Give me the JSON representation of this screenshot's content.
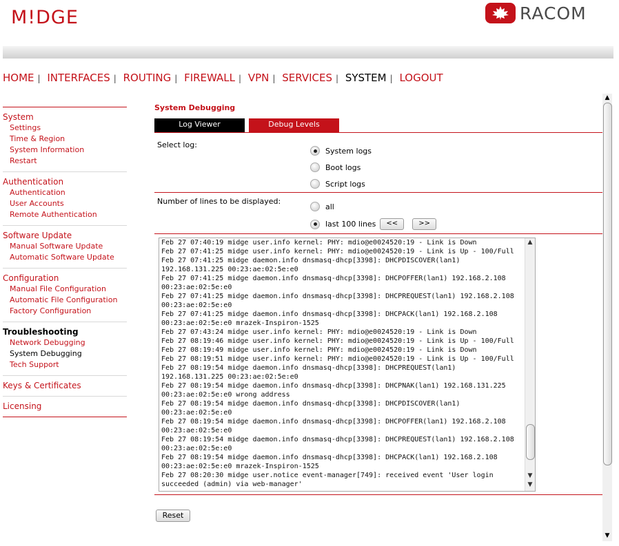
{
  "brand": {
    "product": "M!DGE",
    "vendor": "RACOM"
  },
  "nav": [
    {
      "label": "HOME",
      "active": false
    },
    {
      "label": "INTERFACES",
      "active": false
    },
    {
      "label": "ROUTING",
      "active": false
    },
    {
      "label": "FIREWALL",
      "active": false
    },
    {
      "label": "VPN",
      "active": false
    },
    {
      "label": "SERVICES",
      "active": false
    },
    {
      "label": "SYSTEM",
      "active": true
    },
    {
      "label": "LOGOUT",
      "active": false
    }
  ],
  "sidebar": [
    {
      "title": "System",
      "current": false,
      "items": [
        {
          "label": "Settings",
          "current": false
        },
        {
          "label": "Time & Region",
          "current": false
        },
        {
          "label": "System Information",
          "current": false
        },
        {
          "label": "Restart",
          "current": false
        }
      ]
    },
    {
      "title": "Authentication",
      "current": false,
      "items": [
        {
          "label": "Authentication",
          "current": false
        },
        {
          "label": "User Accounts",
          "current": false
        },
        {
          "label": "Remote Authentication",
          "current": false
        }
      ]
    },
    {
      "title": "Software Update",
      "current": false,
      "items": [
        {
          "label": "Manual Software Update",
          "current": false
        },
        {
          "label": "Automatic Software Update",
          "current": false
        }
      ]
    },
    {
      "title": "Configuration",
      "current": false,
      "items": [
        {
          "label": "Manual File Configuration",
          "current": false
        },
        {
          "label": "Automatic File Configuration",
          "current": false
        },
        {
          "label": "Factory Configuration",
          "current": false
        }
      ]
    },
    {
      "title": "Troubleshooting",
      "current": true,
      "items": [
        {
          "label": "Network Debugging",
          "current": false
        },
        {
          "label": "System Debugging",
          "current": true
        },
        {
          "label": "Tech Support",
          "current": false
        }
      ]
    },
    {
      "title": "Keys & Certificates",
      "current": false,
      "items": []
    },
    {
      "title": "Licensing",
      "current": false,
      "items": []
    }
  ],
  "page": {
    "title": "System Debugging",
    "tabs": [
      {
        "label": "Log Viewer",
        "active": true
      },
      {
        "label": "Debug Levels",
        "active": false
      }
    ],
    "select_log": {
      "label": "Select log:",
      "options": [
        {
          "label": "System logs",
          "selected": true
        },
        {
          "label": "Boot logs",
          "selected": false
        },
        {
          "label": "Script logs",
          "selected": false
        }
      ]
    },
    "lines": {
      "label": "Number of lines to be displayed:",
      "options": [
        {
          "label": "all",
          "selected": false
        },
        {
          "label": "last 100 lines",
          "selected": true
        }
      ],
      "prev_label": "<<",
      "next_label": ">>"
    },
    "log": [
      "Feb 27 07:40:19 midge user.info kernel: PHY: mdio@e0024520:19 - Link is Down",
      "Feb 27 07:41:25 midge user.info kernel: PHY: mdio@e0024520:19 - Link is Up - 100/Full",
      "Feb 27 07:41:25 midge daemon.info dnsmasq-dhcp[3398]: DHCPDISCOVER(lan1)",
      "192.168.131.225 00:23:ae:02:5e:e0",
      "Feb 27 07:41:25 midge daemon.info dnsmasq-dhcp[3398]: DHCPOFFER(lan1) 192.168.2.108",
      "00:23:ae:02:5e:e0",
      "Feb 27 07:41:25 midge daemon.info dnsmasq-dhcp[3398]: DHCPREQUEST(lan1) 192.168.2.108",
      "00:23:ae:02:5e:e0",
      "Feb 27 07:41:25 midge daemon.info dnsmasq-dhcp[3398]: DHCPACK(lan1) 192.168.2.108",
      "00:23:ae:02:5e:e0 mrazek-Inspiron-1525",
      "Feb 27 07:43:24 midge user.info kernel: PHY: mdio@e0024520:19 - Link is Down",
      "Feb 27 08:19:46 midge user.info kernel: PHY: mdio@e0024520:19 - Link is Up - 100/Full",
      "Feb 27 08:19:49 midge user.info kernel: PHY: mdio@e0024520:19 - Link is Down",
      "Feb 27 08:19:51 midge user.info kernel: PHY: mdio@e0024520:19 - Link is Up - 100/Full",
      "Feb 27 08:19:54 midge daemon.info dnsmasq-dhcp[3398]: DHCPREQUEST(lan1)",
      "192.168.131.225 00:23:ae:02:5e:e0",
      "Feb 27 08:19:54 midge daemon.info dnsmasq-dhcp[3398]: DHCPNAK(lan1) 192.168.131.225",
      "00:23:ae:02:5e:e0 wrong address",
      "Feb 27 08:19:54 midge daemon.info dnsmasq-dhcp[3398]: DHCPDISCOVER(lan1)",
      "00:23:ae:02:5e:e0",
      "Feb 27 08:19:54 midge daemon.info dnsmasq-dhcp[3398]: DHCPOFFER(lan1) 192.168.2.108",
      "00:23:ae:02:5e:e0",
      "Feb 27 08:19:54 midge daemon.info dnsmasq-dhcp[3398]: DHCPREQUEST(lan1) 192.168.2.108",
      "00:23:ae:02:5e:e0",
      "Feb 27 08:19:54 midge daemon.info dnsmasq-dhcp[3398]: DHCPACK(lan1) 192.168.2.108",
      "00:23:ae:02:5e:e0 mrazek-Inspiron-1525",
      "Feb 27 08:20:30 midge user.notice event-manager[749]: received event 'User login",
      "succeeded (admin) via web-manager'"
    ],
    "reset_label": "Reset"
  },
  "colors": {
    "accent": "#c4121a",
    "tab_active": "#000000"
  }
}
